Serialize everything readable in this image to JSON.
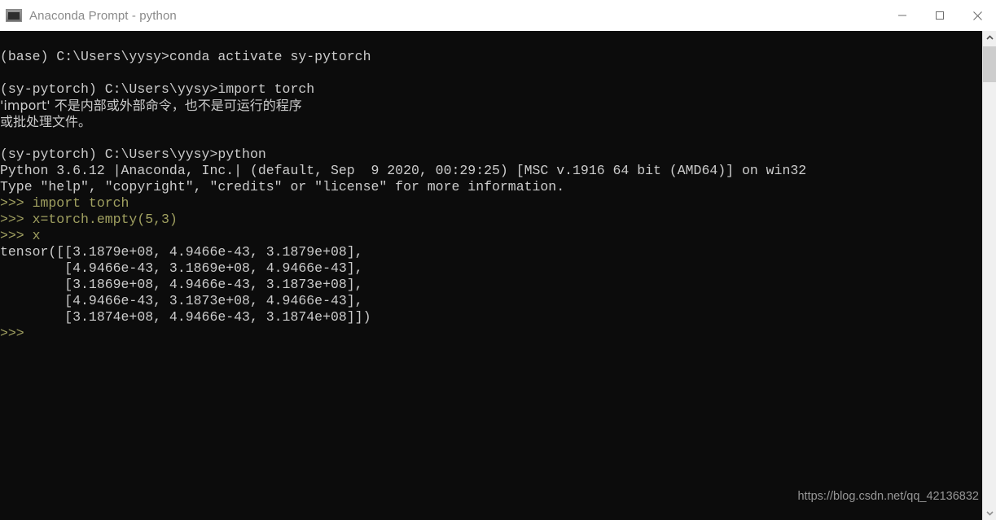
{
  "window": {
    "title": "Anaconda Prompt - python",
    "icon": "console-icon",
    "controls": {
      "minimize": "minimize-icon",
      "maximize": "maximize-icon",
      "close": "close-icon"
    },
    "background": "#ffffff"
  },
  "terminal": {
    "background": "#0c0c0c",
    "foreground": "#cccccc",
    "prompt_color": "#a0a060",
    "lines": [
      "(base) C:\\Users\\yysy>conda activate sy-pytorch",
      "",
      "(sy-pytorch) C:\\Users\\yysy>import torch",
      "'import' 不是内部或外部命令，也不是可运行的程序",
      "或批处理文件。",
      "",
      "(sy-pytorch) C:\\Users\\yysy>python",
      "Python 3.6.12 |Anaconda, Inc.| (default, Sep  9 2020, 00:29:25) [MSC v.1916 64 bit (AMD64)] on win32",
      "Type \"help\", \"copyright\", \"credits\" or \"license\" for more information.",
      ">>> import torch",
      ">>> x=torch.empty(5,3)",
      ">>> x",
      "tensor([[3.1879e+08, 4.9466e-43, 3.1879e+08],",
      "        [4.9466e-43, 3.1869e+08, 4.9466e-43],",
      "        [3.1869e+08, 4.9466e-43, 3.1873e+08],",
      "        [4.9466e-43, 3.1873e+08, 4.9466e-43],",
      "        [3.1874e+08, 4.9466e-43, 3.1874e+08]])",
      ">>>"
    ]
  },
  "watermark": {
    "text": "https://blog.csdn.net/qq_42136832",
    "color": "#b5b5b5"
  },
  "scrollbar": {
    "up_arrow": "chevron-up-icon",
    "down_arrow": "chevron-down-icon",
    "thumb_color": "#cdcdcd",
    "track_color": "#f0f0f0"
  }
}
